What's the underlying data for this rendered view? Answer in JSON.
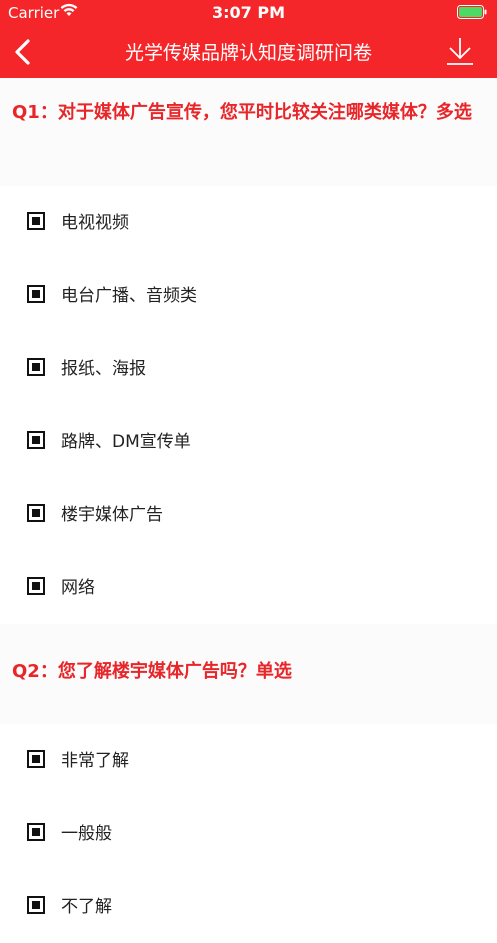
{
  "status_bar": {
    "carrier": "Carrier",
    "time": "3:07 PM"
  },
  "nav": {
    "title": "光学传媒品牌认知度调研问卷",
    "back_icon": "chevron-left-icon",
    "download_icon": "download-icon"
  },
  "colors": {
    "brand_red": "#f5262a",
    "question_red": "#e8262a",
    "battery_green": "#4cd964"
  },
  "questions": [
    {
      "text": "Q1：对于媒体广告宣传，您平时比较关注哪类媒体？多选",
      "options": [
        "电视视频",
        "电台广播、音频类",
        "报纸、海报",
        "路牌、DM宣传单",
        "楼宇媒体广告",
        "网络"
      ]
    },
    {
      "text": "Q2：您了解楼宇媒体广告吗？单选",
      "options": [
        "非常了解",
        "一般般",
        "不了解"
      ]
    }
  ]
}
